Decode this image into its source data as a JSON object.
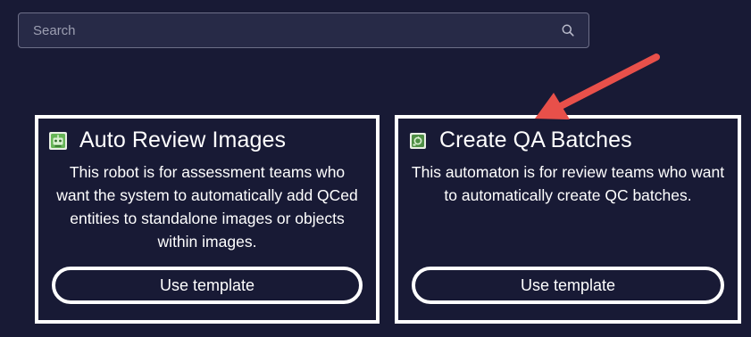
{
  "search": {
    "placeholder": "Search",
    "icon": "search-icon"
  },
  "cards": [
    {
      "title": "Auto Review Images",
      "icon": "robot-icon",
      "description": "This robot is for assessment teams who want the system to automatically add QCed entities to standalone images or objects within images.",
      "button_label": "Use template"
    },
    {
      "title": "Create QA Batches",
      "icon": "batch-icon",
      "description": "This automaton is for review teams who want to automatically create QC batches.",
      "button_label": "Use template"
    }
  ],
  "annotation": {
    "type": "arrow",
    "color": "#e8504a",
    "points_to": "Create QA Batches card"
  },
  "colors": {
    "background": "#181a35",
    "search_bg": "#272a47",
    "card_border": "#ffffff"
  }
}
